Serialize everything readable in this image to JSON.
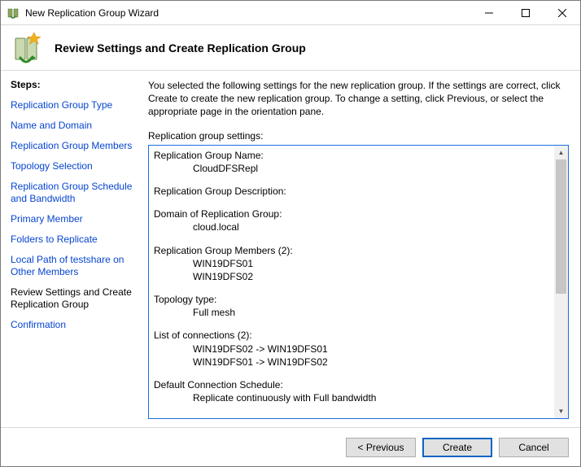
{
  "window": {
    "title": "New Replication Group Wizard"
  },
  "header": {
    "page_title": "Review Settings and Create Replication Group"
  },
  "steps": {
    "heading": "Steps:",
    "items": [
      {
        "label": "Replication Group Type",
        "current": false
      },
      {
        "label": "Name and Domain",
        "current": false
      },
      {
        "label": "Replication Group Members",
        "current": false
      },
      {
        "label": "Topology Selection",
        "current": false
      },
      {
        "label": "Replication Group Schedule and Bandwidth",
        "current": false
      },
      {
        "label": "Primary Member",
        "current": false
      },
      {
        "label": "Folders to Replicate",
        "current": false
      },
      {
        "label": "Local Path of testshare on Other Members",
        "current": false
      },
      {
        "label": "Review Settings and Create Replication Group",
        "current": true
      },
      {
        "label": "Confirmation",
        "current": false
      }
    ]
  },
  "content": {
    "intro": "You selected the following settings for the new replication group. If the settings are correct, click Create to create the new replication group. To change a setting, click Previous, or select the appropriate page in the orientation pane.",
    "settings_label": "Replication group settings:",
    "groups": [
      {
        "key": "Replication Group Name:",
        "values": [
          "CloudDFSRepl"
        ]
      },
      {
        "key": "Replication Group Description:",
        "values": [
          ""
        ]
      },
      {
        "key": "Domain of Replication Group:",
        "values": [
          "cloud.local"
        ]
      },
      {
        "key": "Replication Group Members (2):",
        "values": [
          "WIN19DFS01",
          "WIN19DFS02"
        ]
      },
      {
        "key": "Topology type:",
        "values": [
          "Full mesh"
        ]
      },
      {
        "key": "List of connections (2):",
        "values": [
          "WIN19DFS02 -> WIN19DFS01",
          "WIN19DFS01 -> WIN19DFS02"
        ]
      },
      {
        "key": "Default Connection Schedule:",
        "values": [
          "Replicate continuously with Full bandwidth"
        ]
      }
    ]
  },
  "buttons": {
    "previous": "< Previous",
    "create": "Create",
    "cancel": "Cancel"
  }
}
